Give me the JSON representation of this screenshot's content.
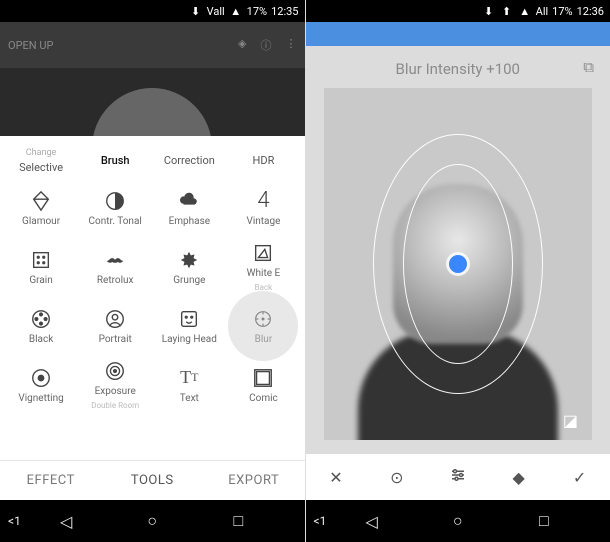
{
  "status": {
    "left": {
      "network": "Vall",
      "battery": "17%",
      "time": "12:35"
    },
    "right": {
      "network": "All",
      "battery": "17%",
      "time": "12:36"
    }
  },
  "left_pane": {
    "header": {
      "open": "OPEN UP"
    },
    "top_row": [
      {
        "sub": "Change",
        "label": "Selective"
      },
      {
        "label": "Brush"
      },
      {
        "label": "Correction"
      },
      {
        "label": "HDR"
      }
    ],
    "grid": [
      [
        {
          "icon": "diamond",
          "label": "Glamour"
        },
        {
          "icon": "contrast",
          "label": "Contr. Tonal"
        },
        {
          "icon": "cloud",
          "label": "Emphase"
        },
        {
          "icon": "four",
          "label": "Vintage"
        }
      ],
      [
        {
          "icon": "grain",
          "label": "Grain"
        },
        {
          "icon": "mustache",
          "label": "Retrolux"
        },
        {
          "icon": "grunge",
          "label": "Grunge"
        },
        {
          "icon": "triangle",
          "label": "White E",
          "sub": "Back"
        }
      ],
      [
        {
          "icon": "reel",
          "label": "Black"
        },
        {
          "icon": "person",
          "label": "Portrait"
        },
        {
          "icon": "face",
          "label": "Laying Head"
        },
        {
          "icon": "blur",
          "label": "Blur",
          "highlight": true
        }
      ],
      [
        {
          "icon": "circle-dot",
          "label": "Vignetting"
        },
        {
          "icon": "target",
          "label": "Exposure",
          "sub": "Double Room"
        },
        {
          "icon": "text",
          "label": "Text"
        },
        {
          "icon": "frame",
          "label": "Comic"
        }
      ]
    ],
    "tabs": {
      "effect": "EFFECT",
      "tools": "TOOLS",
      "export": "EXPORT"
    }
  },
  "right_pane": {
    "label": "Blur Intensity +100"
  },
  "nav": {
    "prev": "<1"
  }
}
